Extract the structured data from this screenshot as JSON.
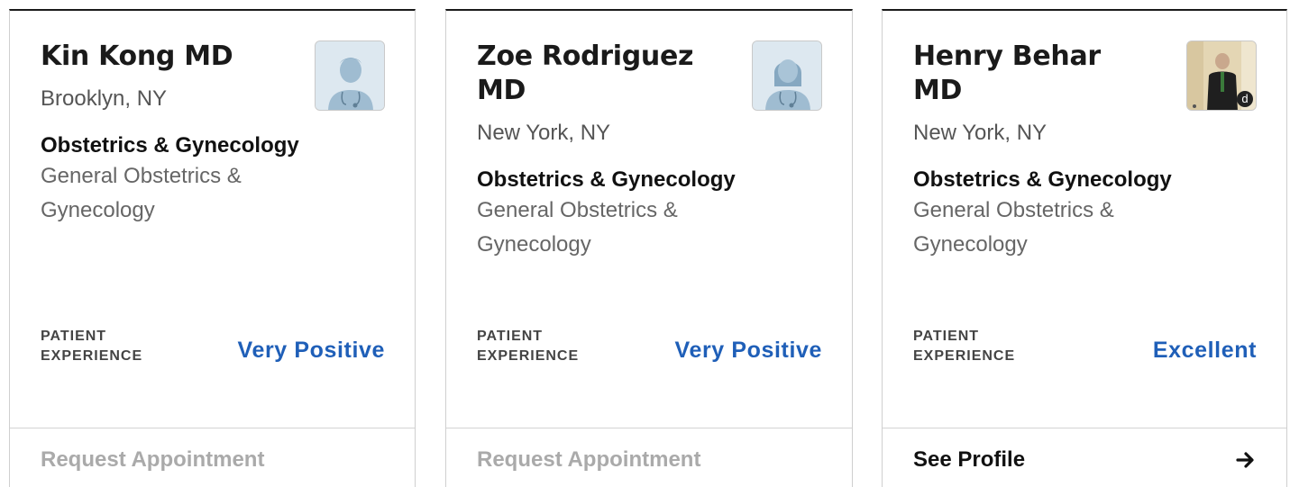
{
  "cards": [
    {
      "name": "Kin Kong MD",
      "location": "Brooklyn, NY",
      "specialty": "Obstetrics & Gynecology",
      "subspecialty": "General Obstetrics & Gynecology",
      "patient_experience_label_line1": "PATIENT",
      "patient_experience_label_line2": "EXPERIENCE",
      "patient_experience_value": "Very Positive",
      "action_label": "Request Appointment",
      "photo": "male-doctor-avatar-icon"
    },
    {
      "name": "Zoe Rodriguez MD",
      "location": "New York, NY",
      "specialty": "Obstetrics & Gynecology",
      "subspecialty": "General Obstetrics & Gynecology",
      "patient_experience_label_line1": "PATIENT",
      "patient_experience_label_line2": "EXPERIENCE",
      "patient_experience_value": "Very Positive",
      "action_label": "Request Appointment",
      "photo": "female-doctor-avatar-icon"
    },
    {
      "name": "Henry Behar MD",
      "location": "New York, NY",
      "specialty": "Obstetrics & Gynecology",
      "subspecialty": "General Obstetrics & Gynecology",
      "patient_experience_label_line1": "PATIENT",
      "patient_experience_label_line2": "EXPERIENCE",
      "patient_experience_value": "Excellent",
      "action_label": "See Profile",
      "photo": "doctor-photo",
      "photo_badge": "d"
    }
  ],
  "colors": {
    "rating_blue": "#1f5fb8",
    "disabled_text": "#aaaaaa",
    "border": "#cfcfcf",
    "avatar_bg": "#dde8f0",
    "avatar_figure": "#9fbcd1"
  }
}
